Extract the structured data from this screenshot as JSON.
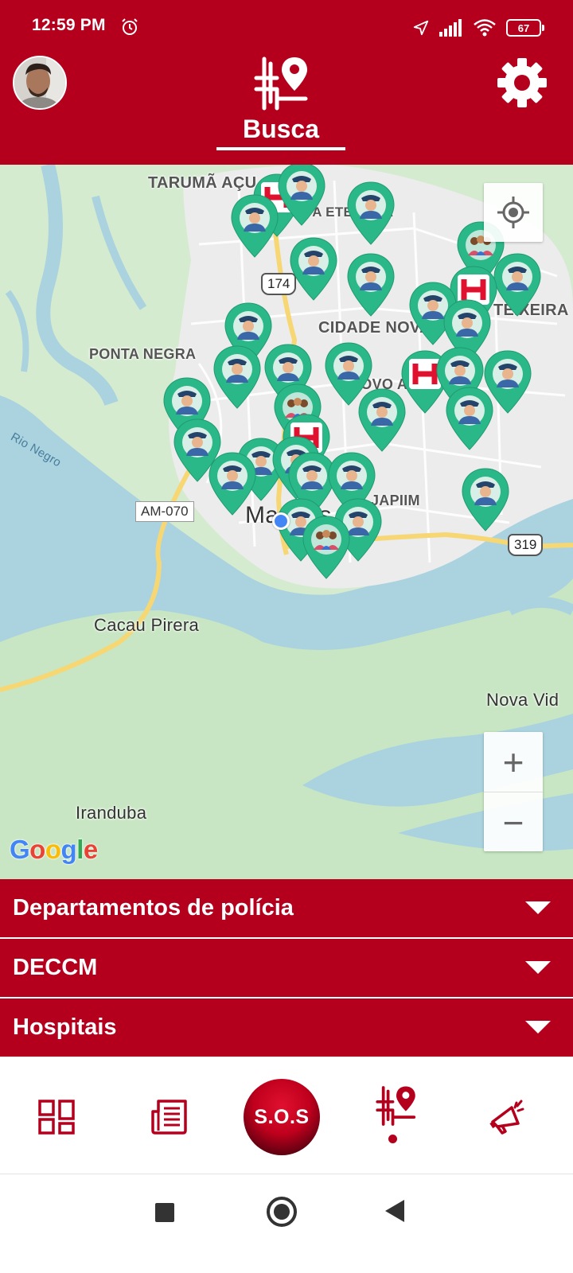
{
  "status_bar": {
    "time": "12:59 PM",
    "battery": "67",
    "icons": [
      "alarm-icon",
      "location-arrow-icon",
      "signal-icon",
      "wifi-icon",
      "battery-icon"
    ]
  },
  "header": {
    "title": "Busca",
    "logo_icon": "map-route-pin-icon",
    "settings_icon": "gear-icon",
    "avatar_icon": "user-avatar"
  },
  "map": {
    "labels": {
      "taruma": "TARUMÃ AÇU",
      "santa_etelvina": "SANTA ETELVINA",
      "cidade_nova": "CIDADE NOVA",
      "ponta_negra": "PONTA NEGRA",
      "novo_aleixo": "NOVO ALEIXO",
      "teixeira": "TEIXEIRA",
      "japiim": "JAPIIM",
      "manaus": "Manaus",
      "rio_negro": "Rio Negro",
      "cacau_pirera": "Cacau Pirera",
      "nova_vida": "Nova Vid",
      "iranduba": "Iranduba"
    },
    "roads": {
      "am070": "AM-070",
      "r174": "174",
      "r319": "319"
    },
    "attribution": "Google",
    "zoom_in": "+",
    "zoom_out": "−",
    "marker_types": [
      "police-station-marker",
      "hospital-marker",
      "deccm-marker"
    ]
  },
  "accordion": [
    {
      "label": "Departamentos de polícia"
    },
    {
      "label": "DECCM"
    },
    {
      "label": "Hospitais"
    }
  ],
  "bottom_nav": {
    "items": [
      "dashboard-icon",
      "news-icon",
      "sos-button",
      "map-search-icon",
      "megaphone-icon"
    ],
    "sos_label": "S.O.S",
    "active": "map-search-icon"
  },
  "colors": {
    "primary": "#b4001d",
    "marker": "#2bb889",
    "water": "#aad3df",
    "land": "#c8e6c3",
    "urban": "#ececec"
  }
}
